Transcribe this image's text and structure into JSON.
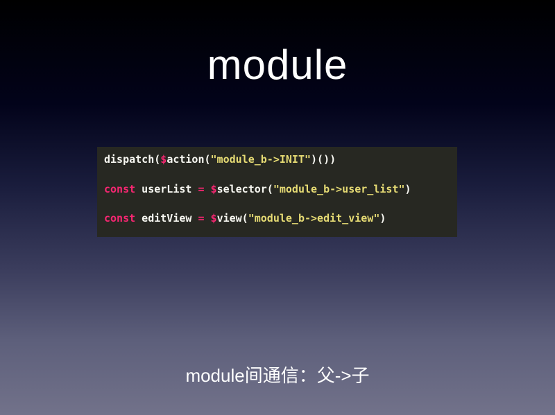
{
  "slide": {
    "title": "module",
    "caption": "module间通信：父->子"
  },
  "code": {
    "line1": {
      "fn": "dispatch(",
      "dollar": "$",
      "call": "action(",
      "str": "\"module_b->INIT\"",
      "tail": ")())"
    },
    "line2": {
      "kw": "const",
      "name": " userList ",
      "op": "=",
      "sp": " ",
      "dollar": "$",
      "call": "selector(",
      "str": "\"module_b->user_list\"",
      "tail": ")"
    },
    "line3": {
      "kw": "const",
      "name": " editView ",
      "op": "=",
      "sp": " ",
      "dollar": "$",
      "call": "view(",
      "str": "\"module_b->edit_view\"",
      "tail": ")"
    }
  },
  "colors": {
    "code_background": "#272822",
    "keyword": "#f92672",
    "string": "#e6db74",
    "plain": "#f8f8f2"
  }
}
